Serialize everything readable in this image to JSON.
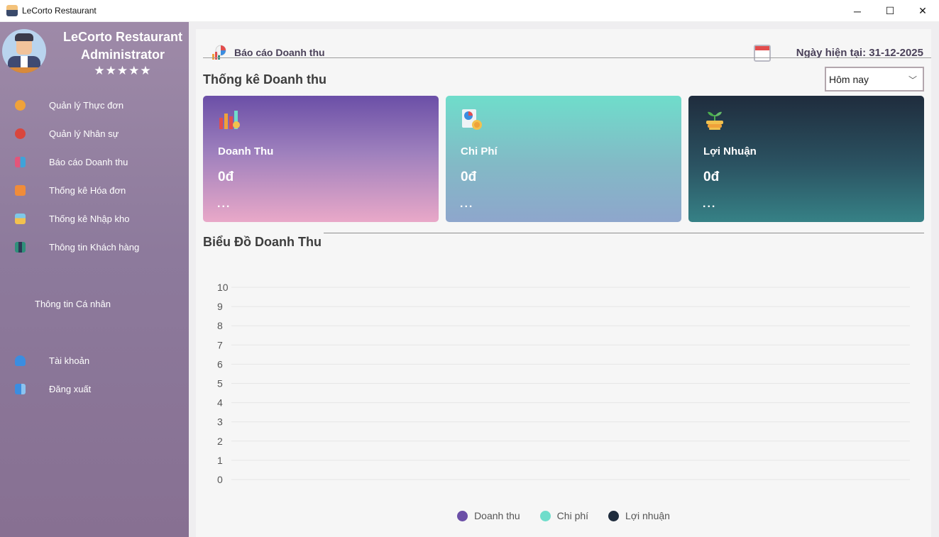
{
  "window": {
    "title": "LeCorto Restaurant",
    "minimize_glyph": "─",
    "maximize_glyph": "☐",
    "close_glyph": "✕"
  },
  "sidebar": {
    "profile": {
      "name_line1": "LeCorto Restaurant",
      "name_line2": "Administrator",
      "stars": "★★★★★"
    },
    "items": [
      {
        "label": "Quản lý Thực đơn",
        "icon": "menu-book-icon",
        "color": "#f0a23a"
      },
      {
        "label": "Quản lý Nhân sự",
        "icon": "staff-icon",
        "color": "#d9463d"
      },
      {
        "label": "Báo cáo Doanh thu",
        "icon": "report-chart-icon",
        "color": "#e3557a"
      },
      {
        "label": "Thống kê Hóa đơn",
        "icon": "invoice-icon",
        "color": "#f08c3a"
      },
      {
        "label": "Thống kê Nhập kho",
        "icon": "warehouse-icon",
        "color": "#f2c14e"
      },
      {
        "label": "Thông tin Khách hàng",
        "icon": "customers-icon",
        "color": "#2f8f7a"
      }
    ],
    "personal_header": "Thông tin Cá nhân",
    "account": {
      "label": "Tài khoản",
      "icon": "account-icon",
      "color": "#3b8de0"
    },
    "logout": {
      "label": "Đăng xuất",
      "icon": "logout-icon",
      "color": "#3b8de0"
    }
  },
  "header": {
    "title": "Báo cáo Doanh thu",
    "date_label": "Ngày hiện tại: 31-12-2025"
  },
  "stats": {
    "section_title": "Thống kê Doanh thu",
    "period": "Hôm nay",
    "cards": [
      {
        "title": "Doanh Thu",
        "value": "0đ",
        "more": "...",
        "icon": "revenue-bars-icon"
      },
      {
        "title": "Chi Phí",
        "value": "0đ",
        "more": "...",
        "icon": "expense-pie-icon"
      },
      {
        "title": "Lợi Nhuận",
        "value": "0đ",
        "more": "...",
        "icon": "profit-plant-icon"
      }
    ]
  },
  "chart_title": "Biểu Đồ Doanh Thu",
  "chart_data": {
    "type": "line",
    "x": [],
    "series": [
      {
        "name": "Doanh thu",
        "values": [],
        "color": "#6b4fa7"
      },
      {
        "name": "Chi phí",
        "values": [],
        "color": "#6fddcb"
      },
      {
        "name": "Lợi nhuận",
        "values": [],
        "color": "#1f2c3d"
      }
    ],
    "ylim": [
      0,
      10
    ],
    "yticks": [
      "0",
      "1",
      "2",
      "3",
      "4",
      "5",
      "6",
      "7",
      "8",
      "9",
      "10"
    ],
    "grid": true,
    "legend": "bottom"
  }
}
